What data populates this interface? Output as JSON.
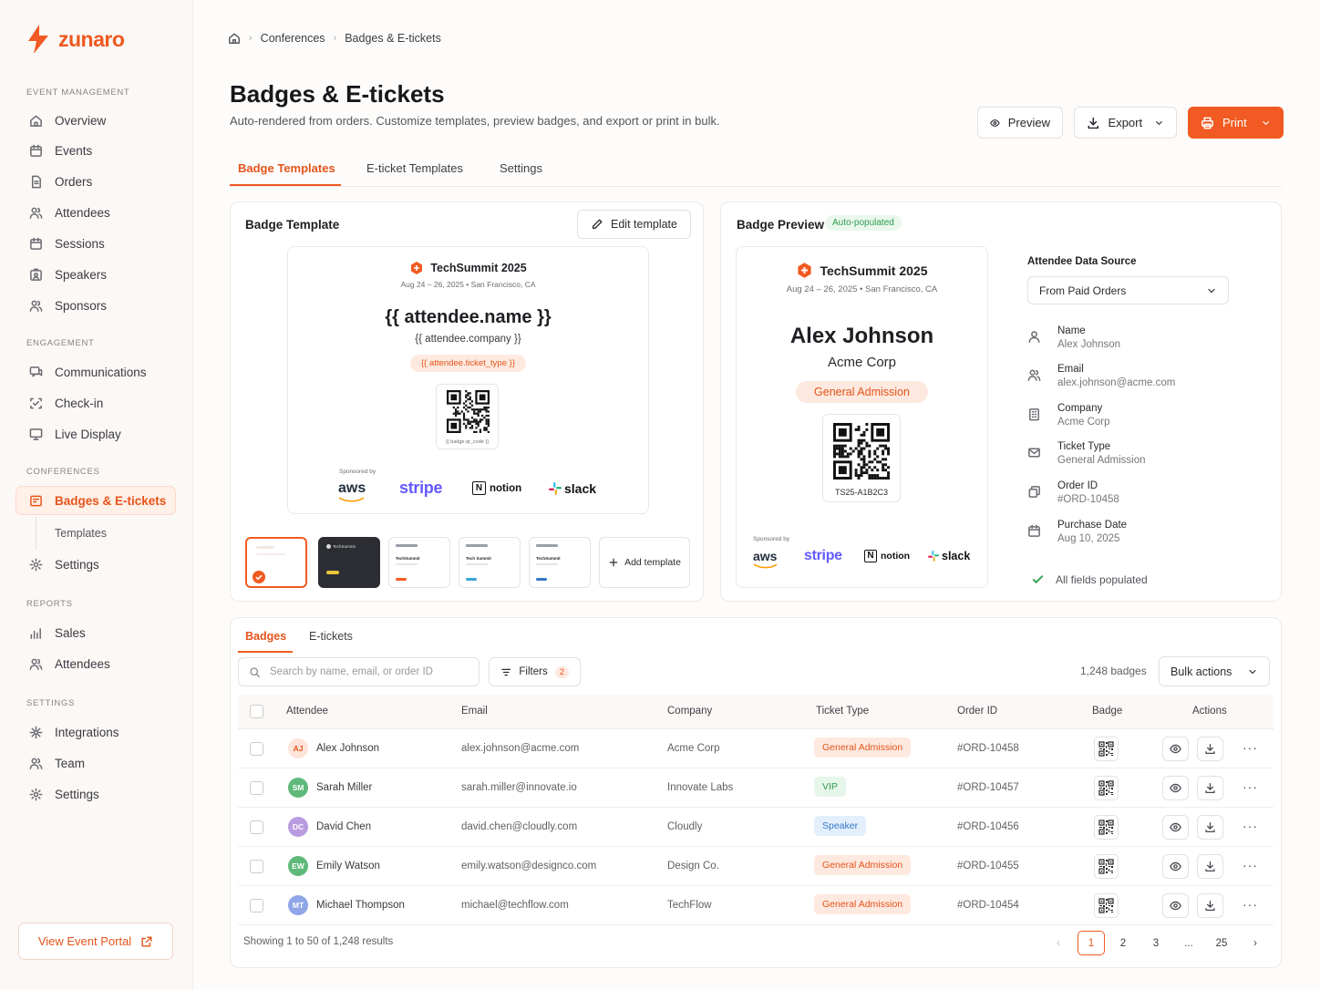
{
  "brand": {
    "name": "zunaro",
    "accent": "#f15a22"
  },
  "sidebar": {
    "sections": [
      {
        "title": "EVENT MANAGEMENT",
        "items": [
          "Overview",
          "Events",
          "Orders",
          "Attendees",
          "Sessions",
          "Speakers",
          "Sponsors"
        ]
      },
      {
        "title": "ENGAGEMENT",
        "items": [
          "Communications",
          "Check-in",
          "Live Display"
        ]
      },
      {
        "title": "CONFERENCES",
        "items": [
          "Badges & E-tickets",
          "Templates",
          "Settings"
        ]
      },
      {
        "title": "REPORTS",
        "items": [
          "Sales",
          "Attendees"
        ]
      },
      {
        "title": "SETTINGS",
        "items": [
          "Integrations",
          "Team",
          "Settings"
        ]
      }
    ],
    "active_item": "Badges & E-tickets",
    "portal_label": "View Event Portal"
  },
  "breadcrumb": [
    "Conferences",
    "Badges & E-tickets"
  ],
  "page": {
    "title": "Badges & E-tickets",
    "subtitle": "Auto-rendered from orders. Customize templates, preview badges, and export or print in bulk.",
    "preview_label": "Preview",
    "export_label": "Export",
    "print_label": "Print"
  },
  "tabs": [
    "Badge Templates",
    "E-ticket Templates",
    "Settings"
  ],
  "template_card": {
    "title": "Badge Template",
    "edit_label": "Edit template",
    "event_name": "TechSummit 2025",
    "event_meta": "Aug 24 – 26, 2025 • San Francisco, CA",
    "name_token": "{{ attendee.name }}",
    "company_token": "{{ attendee.company }}",
    "type_token": "{{ attendee.ticket_type }}",
    "qr_token": "{{ badge.qr_code }}",
    "sponsored_by": "Sponsored by",
    "sponsors": [
      "aws",
      "stripe",
      "notion",
      "slack"
    ],
    "thumbnails": [
      "TechSummit",
      "TechSummit",
      "Tech Summit",
      "TechSummit",
      "TechSummit"
    ],
    "add_template_label": "Add template"
  },
  "preview_card": {
    "title": "Badge Preview",
    "status_pill": "Auto-populated",
    "event_name": "TechSummit 2025",
    "event_meta": "Aug 24 – 26, 2025 • San Francisco, CA",
    "attendee_name": "Alex Johnson",
    "company": "Acme Corp",
    "ticket_type": "General Admission",
    "ticket_code": "TS25-A1B2C3",
    "sponsored_by": "Sponsored by",
    "data_source_label": "Attendee Data Source",
    "data_source_value": "From Paid Orders",
    "fields": [
      {
        "label": "Name",
        "value": "Alex Johnson",
        "icon": "user-icon"
      },
      {
        "label": "Email",
        "value": "alex.johnson@acme.com",
        "icon": "users-icon"
      },
      {
        "label": "Company",
        "value": "Acme Corp",
        "icon": "building-icon"
      },
      {
        "label": "Ticket Type",
        "value": "General Admission",
        "icon": "mail-icon"
      },
      {
        "label": "Order ID",
        "value": "#ORD-10458",
        "icon": "copy-icon"
      },
      {
        "label": "Purchase Date",
        "value": "Aug 10, 2025",
        "icon": "calendar-icon"
      }
    ],
    "all_fields_label": "All fields populated"
  },
  "table_section": {
    "tabs": [
      "Badges",
      "E-tickets"
    ],
    "search_placeholder": "Search by name, email, or order ID",
    "filters_label": "Filters",
    "filters_count": "2",
    "badge_count": "1,248 badges",
    "bulk_actions_label": "Bulk actions",
    "columns": [
      "Attendee",
      "Email",
      "Company",
      "Ticket Type",
      "Order ID",
      "Badge",
      "Actions"
    ],
    "rows": [
      {
        "initials": "AJ",
        "name": "Alex Johnson",
        "email": "alex.johnson@acme.com",
        "company": "Acme Corp",
        "ticket": "General Admission",
        "ticket_kind": "ga",
        "order": "#ORD-10458",
        "avatar_bg": "#fde3da",
        "avatar_fg": "#e5541b"
      },
      {
        "initials": "SM",
        "name": "Sarah Miller",
        "email": "sarah.miller@innovate.io",
        "company": "Innovate Labs",
        "ticket": "VIP",
        "ticket_kind": "vip",
        "order": "#ORD-10457",
        "avatar_bg": "#5fb97a",
        "avatar_fg": "#ffffff"
      },
      {
        "initials": "DC",
        "name": "David Chen",
        "email": "david.chen@cloudly.com",
        "company": "Cloudly",
        "ticket": "Speaker",
        "ticket_kind": "sp",
        "order": "#ORD-10456",
        "avatar_bg": "#b99be0",
        "avatar_fg": "#ffffff"
      },
      {
        "initials": "EW",
        "name": "Emily Watson",
        "email": "emily.watson@designco.com",
        "company": "Design Co.",
        "ticket": "General Admission",
        "ticket_kind": "ga",
        "order": "#ORD-10455",
        "avatar_bg": "#5fb97a",
        "avatar_fg": "#ffffff"
      },
      {
        "initials": "MT",
        "name": "Michael Thompson",
        "email": "michael@techflow.com",
        "company": "TechFlow",
        "ticket": "General Admission",
        "ticket_kind": "ga",
        "order": "#ORD-10454",
        "avatar_bg": "#8fa6e8",
        "avatar_fg": "#ffffff"
      }
    ],
    "showing_text": "Showing 1 to 50 of 1,248 results",
    "pages": [
      "1",
      "2",
      "3",
      "...",
      "25"
    ],
    "current_page": "1"
  }
}
